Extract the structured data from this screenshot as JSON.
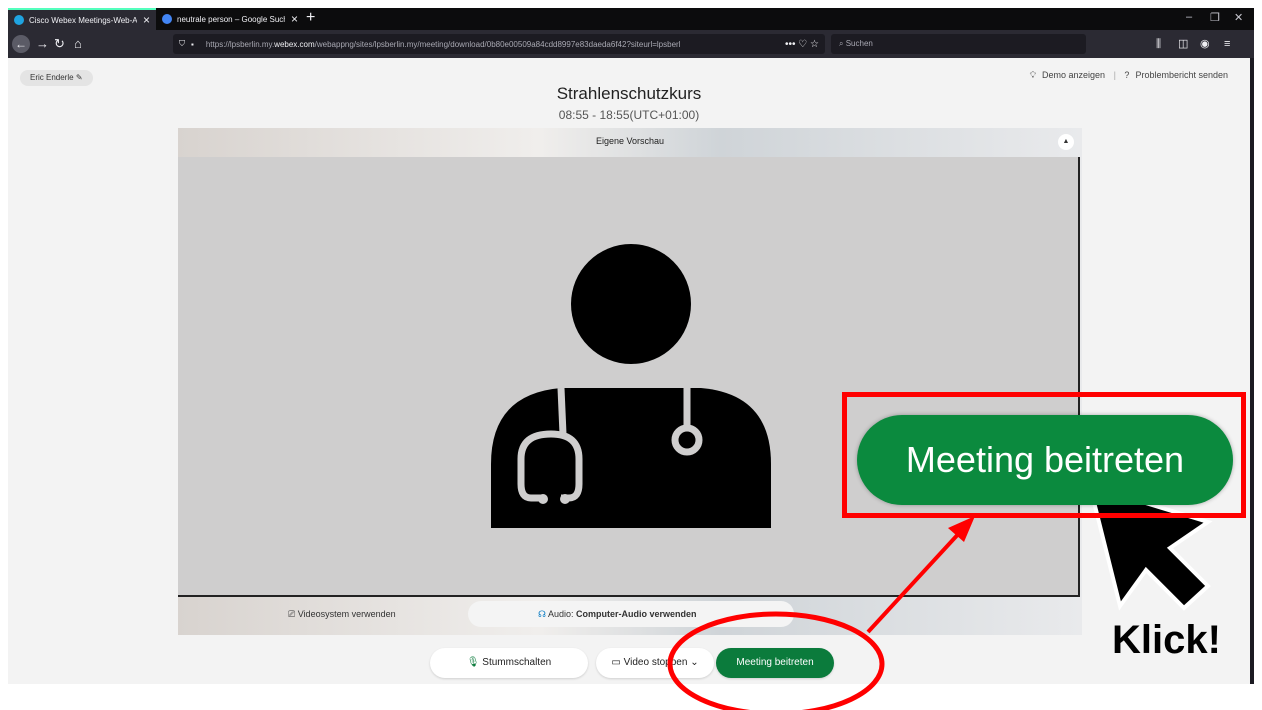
{
  "browser": {
    "tabs": [
      {
        "label": "Cisco Webex Meetings-Web-A",
        "favicon_color": "#1fa3e0"
      },
      {
        "label": "neutrale person – Google Such",
        "favicon_color": "#4285f4"
      }
    ],
    "new_tab": "+",
    "url_prefix": "https://lpsberlin.my.",
    "url_domain": "webex.com",
    "url_rest": "/webappng/sites/lpsberlin.my/meeting/download/0b80e00509a84cdd8997e83daeda6f42?siteurl=lpsberl",
    "url_actions": "••• ♡ ☆",
    "search_placeholder": "Suchen"
  },
  "page": {
    "user_name": "Eric Enderle",
    "demo_link": "Demo anzeigen",
    "report_link": "Problembericht senden",
    "meeting_title": "Strahlenschutzkurs",
    "meeting_time": "08:55 - 18:55(UTC+01:00)",
    "preview_label": "Eigene Vorschau",
    "videosystem_label": "Videosystem verwenden",
    "audio_prefix": "Audio: ",
    "audio_value": "Computer-Audio verwenden",
    "mute_label": "Stummschalten",
    "video_label": "Video stoppen",
    "join_label": "Meeting beitreten"
  },
  "annotation": {
    "join_callout_label": "Meeting beitreten",
    "klick_label": "Klick!",
    "highlight_color": "#ff0000"
  },
  "colors": {
    "join_green": "#0b7b3c",
    "browser_dark": "#2b2a33"
  }
}
